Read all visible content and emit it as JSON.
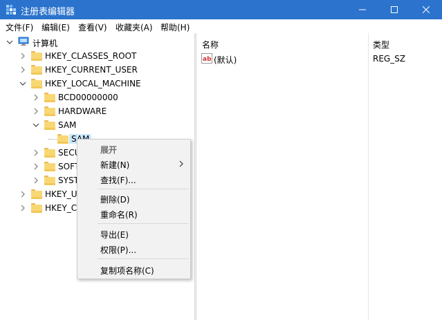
{
  "window": {
    "title": "注册表编辑器",
    "minimize_icon": "minimize-icon",
    "maximize_icon": "maximize-icon",
    "close_icon": "close-icon"
  },
  "menubar": {
    "file": "文件(F)",
    "edit": "编辑(E)",
    "view": "查看(V)",
    "favorites": "收藏夹(A)",
    "help": "帮助(H)"
  },
  "tree": {
    "root": "计算机",
    "nodes": [
      "HKEY_CLASSES_ROOT",
      "HKEY_CURRENT_USER",
      "HKEY_LOCAL_MACHINE",
      "BCD00000000",
      "HARDWARE",
      "SAM",
      "SAM",
      "SECU",
      "SOFT",
      "SYST",
      "HKEY_U",
      "HKEY_C"
    ]
  },
  "list": {
    "columns": [
      "名称",
      "类型"
    ],
    "rows": [
      {
        "name": "(默认)",
        "type": "REG_SZ",
        "icon": "string-value-icon"
      }
    ]
  },
  "context_menu": {
    "items": [
      {
        "label": "展开",
        "disabled": true
      },
      {
        "label": "新建(N)",
        "submenu": true
      },
      {
        "label": "查找(F)..."
      },
      {
        "label": "删除(D)"
      },
      {
        "label": "重命名(R)"
      },
      {
        "label": "导出(E)"
      },
      {
        "label": "权限(P)..."
      },
      {
        "label": "复制项名称(C)"
      }
    ]
  },
  "colors": {
    "titlebar": "#2b73cd",
    "selection": "#cce8ff",
    "folder": "#f8d775"
  }
}
